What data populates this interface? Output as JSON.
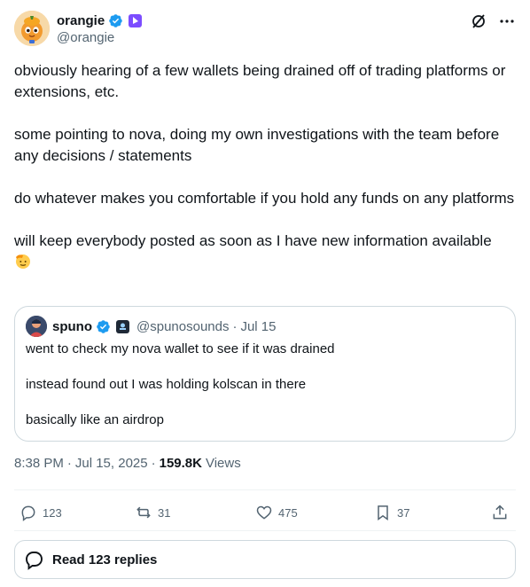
{
  "author": {
    "display_name": "orangie",
    "handle": "@orangie"
  },
  "tweet": {
    "paragraphs": [
      "obviously hearing of a few wallets being drained off of trading platforms or extensions, etc.",
      "some pointing to nova, doing my own investigations with the team before any decisions / statements",
      "do whatever makes you comfortable if you hold any funds on any platforms",
      "will keep everybody posted as soon as I have new information available"
    ],
    "emoji": "saluting-face-emoji"
  },
  "quote": {
    "display_name": "spuno",
    "handle": "@spunosounds",
    "separator": "·",
    "date": "Jul 15",
    "paragraphs": [
      "went to check my nova wallet to see if it was drained",
      "instead found out I was holding kolscan in there",
      "basically like an airdrop"
    ]
  },
  "meta": {
    "time": "8:38 PM",
    "separator": "·",
    "date": "Jul 15, 2025",
    "separator2": "·",
    "views_count": "159.8K",
    "views_label": "Views"
  },
  "actions": {
    "replies": "123",
    "reposts": "31",
    "likes": "475",
    "bookmarks": "37"
  },
  "read_replies_label": "Read 123 replies",
  "colors": {
    "verified": "#1d9bf0",
    "text_primary": "#0f1419",
    "text_secondary": "#536471",
    "border": "#cfd9de"
  }
}
